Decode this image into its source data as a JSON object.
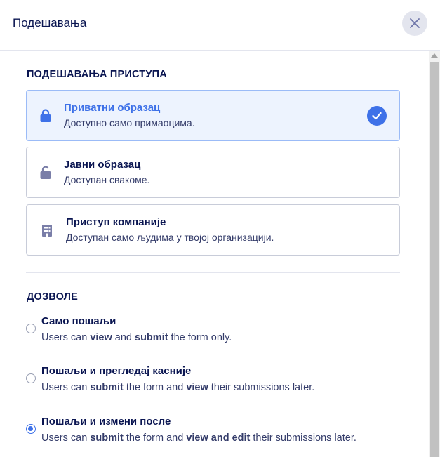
{
  "header": {
    "title": "Подешавања",
    "close_icon": "close-icon"
  },
  "access": {
    "section_title": "ПОДЕШАВАЊА ПРИСТУПА",
    "options": [
      {
        "title": "Приватни образац",
        "description": "Доступно само примаоцима.",
        "icon": "lock-icon",
        "selected": true
      },
      {
        "title": "Јавни образац",
        "description": "Доступан свакоме.",
        "icon": "unlock-icon",
        "selected": false
      },
      {
        "title": "Приступ компаније",
        "description": "Доступан само људима у твојој организацији.",
        "icon": "building-icon",
        "selected": false
      }
    ]
  },
  "permissions": {
    "section_title": "ДОЗВОЛЕ",
    "items": [
      {
        "title": "Само пошаљи",
        "desc": {
          "p1": "Users can ",
          "b1": "view",
          "p2": " and ",
          "b2": "submit",
          "p3": " the form only."
        },
        "checked": false
      },
      {
        "title": "Пошаљи и прегледај касније",
        "desc": {
          "p1": "Users can ",
          "b1": "submit",
          "p2": " the form and ",
          "b2": "view",
          "p3": " their submissions later."
        },
        "checked": false
      },
      {
        "title": "Пошаљи и измени после",
        "desc": {
          "p1": "Users can ",
          "b1": "submit",
          "p2": " the form and ",
          "b2": "view and edit",
          "p3": " their submissions later."
        },
        "checked": true
      }
    ]
  },
  "colors": {
    "accent": "#3e71e8",
    "text": "#0a1551",
    "selected_bg": "#edf3fe"
  }
}
